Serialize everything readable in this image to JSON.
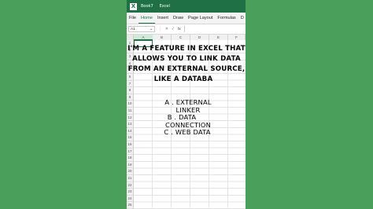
{
  "window": {
    "book": "Book7",
    "app": "Excel"
  },
  "menu": [
    "File",
    "Home",
    "Insert",
    "Draw",
    "Page Layout",
    "Formulas",
    "D"
  ],
  "formula_bar": {
    "name_box": "A1",
    "fx": "fx"
  },
  "columns": [
    "A",
    "B",
    "C",
    "D",
    "E",
    "F"
  ],
  "rows": [
    "1",
    "2",
    "3",
    "4",
    "5",
    "6",
    "7",
    "8",
    "9",
    "10",
    "11",
    "12",
    "13",
    "14",
    "15",
    "16",
    "17",
    "18",
    "19",
    "20",
    "21",
    "22",
    "23",
    "24",
    "25",
    "26"
  ],
  "question": {
    "line1": "I'M A FEATURE IN EXCEL THAT",
    "line2": "ALLOWS YOU TO LINK DATA",
    "line3": "FROM AN EXTERNAL SOURCE,",
    "line4": "LIKE A DATABA"
  },
  "options": {
    "a1": "A . EXTERNAL",
    "a2": "LINKER",
    "b1": "B . DATA",
    "b2": "CONNECTION",
    "c1": "C . WEB DATA"
  },
  "colors": {
    "background": "#4aa05b",
    "excel_green": "#1f7145"
  }
}
